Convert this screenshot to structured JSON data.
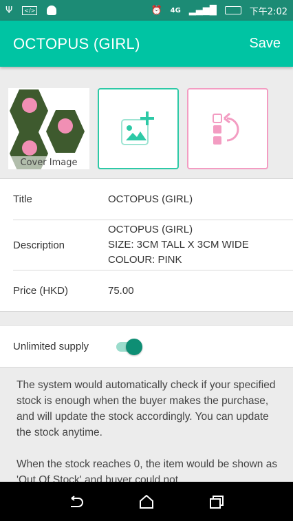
{
  "status_bar": {
    "time": "下午2:02",
    "icons": [
      "usb-icon",
      "debug-icon",
      "android-icon",
      "alarm-icon",
      "4g-icon",
      "signal-icon",
      "battery-charging-icon"
    ]
  },
  "app_bar": {
    "title": "OCTOPUS (GIRL)",
    "save_label": "Save"
  },
  "images": {
    "cover_label": "Cover Image",
    "add_image": "add-image-icon",
    "reorder": "reorder-icon"
  },
  "fields": [
    {
      "label": "Title",
      "value": "OCTOPUS (GIRL)"
    },
    {
      "label": "Description",
      "lines": [
        "OCTOPUS (GIRL)",
        "SIZE: 3CM TALL X 3CM WIDE",
        "COLOUR: PINK"
      ]
    },
    {
      "label": "Price (HKD)",
      "value": "75.00"
    }
  ],
  "supply": {
    "label": "Unlimited supply",
    "enabled": true
  },
  "info": {
    "p1": "The system would automatically check if your specified stock is enough when the buyer makes the purchase, and will update the stock accordingly. You can update the stock anytime.",
    "p2": "When the stock reaches 0, the item would be shown as 'Out Of Stock' and buyer could not"
  },
  "colors": {
    "primary": "#00c4a3",
    "status": "#1c8b75",
    "accent_pink": "#f39cc2"
  }
}
